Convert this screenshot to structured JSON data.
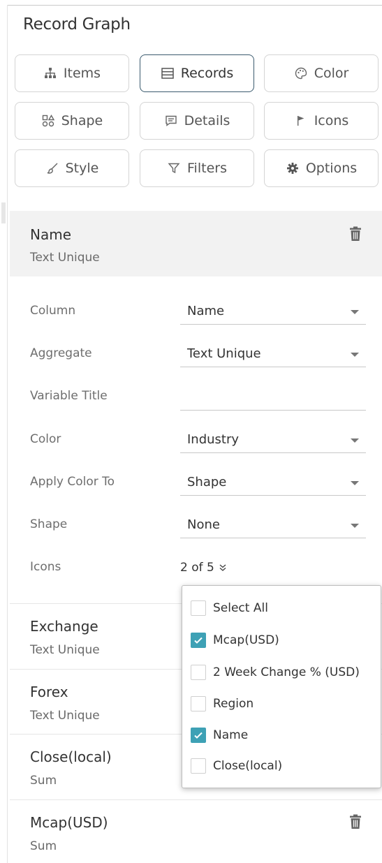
{
  "panel": {
    "title": "Record Graph"
  },
  "tabs": [
    {
      "label": "Items",
      "icon": "hierarchy-icon",
      "active": false
    },
    {
      "label": "Records",
      "icon": "list-icon",
      "active": true
    },
    {
      "label": "Color",
      "icon": "palette-icon",
      "active": false
    },
    {
      "label": "Shape",
      "icon": "shapes-icon",
      "active": false
    },
    {
      "label": "Details",
      "icon": "comment-icon",
      "active": false
    },
    {
      "label": "Icons",
      "icon": "flag-icon",
      "active": false
    },
    {
      "label": "Style",
      "icon": "brush-icon",
      "active": false
    },
    {
      "label": "Filters",
      "icon": "filter-icon",
      "active": false
    },
    {
      "label": "Options",
      "icon": "gear-icon",
      "active": false
    }
  ],
  "selected_variable": {
    "name": "Name",
    "subtitle": "Text Unique"
  },
  "fields": {
    "column": {
      "label": "Column",
      "value": "Name"
    },
    "aggregate": {
      "label": "Aggregate",
      "value": "Text Unique"
    },
    "variable_title": {
      "label": "Variable Title",
      "value": ""
    },
    "color": {
      "label": "Color",
      "value": "Industry"
    },
    "apply_color_to": {
      "label": "Apply Color To",
      "value": "Shape"
    },
    "shape": {
      "label": "Shape",
      "value": "None"
    },
    "icons": {
      "label": "Icons",
      "value": "2 of 5"
    }
  },
  "icons_dropdown": {
    "options": [
      {
        "label": "Select All",
        "checked": false
      },
      {
        "label": "Mcap(USD)",
        "checked": true
      },
      {
        "label": "2 Week Change % (USD)",
        "checked": false
      },
      {
        "label": "Region",
        "checked": false
      },
      {
        "label": "Name",
        "checked": true
      },
      {
        "label": "Close(local)",
        "checked": false
      }
    ]
  },
  "variables": [
    {
      "name": "Exchange",
      "subtitle": "Text Unique"
    },
    {
      "name": "Forex",
      "subtitle": "Text Unique"
    },
    {
      "name": "Close(local)",
      "subtitle": "Sum"
    },
    {
      "name": "Mcap(USD)",
      "subtitle": "Sum"
    }
  ],
  "colors": {
    "accent": "#3ea1b5",
    "active_border": "#3a5a6e",
    "header_bg": "#f2f2f2"
  }
}
